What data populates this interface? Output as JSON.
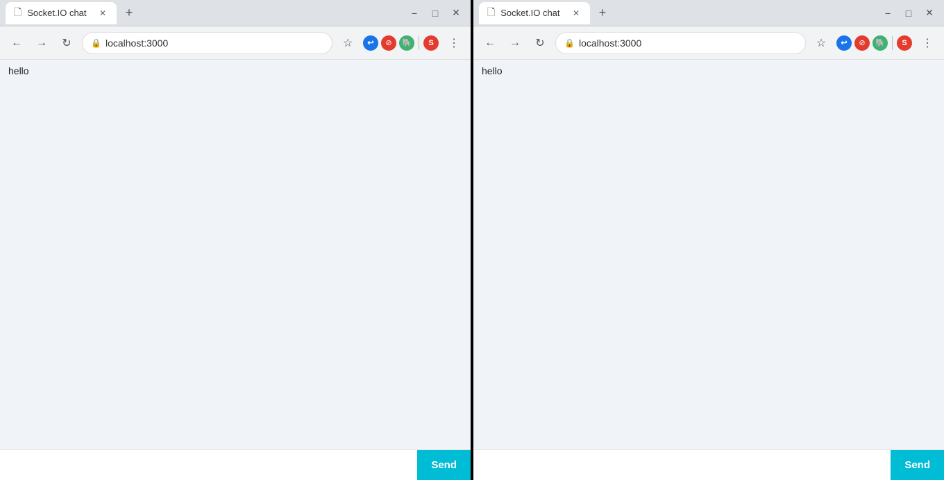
{
  "windows": [
    {
      "id": "window-left",
      "tab": {
        "title": "Socket.IO chat",
        "url": "localhost:3000"
      },
      "messages": [
        {
          "text": "hello"
        }
      ],
      "input_placeholder": "",
      "send_label": "Send"
    },
    {
      "id": "window-right",
      "tab": {
        "title": "Socket.IO chat",
        "url": "localhost:3000"
      },
      "messages": [
        {
          "text": "hello"
        }
      ],
      "input_placeholder": "",
      "send_label": "Send"
    }
  ],
  "window_controls": {
    "minimize": "−",
    "maximize": "□",
    "close": "✕"
  },
  "nav": {
    "back": "←",
    "forward": "→",
    "reload": "↻",
    "star": "☆",
    "menu": "⋮"
  }
}
